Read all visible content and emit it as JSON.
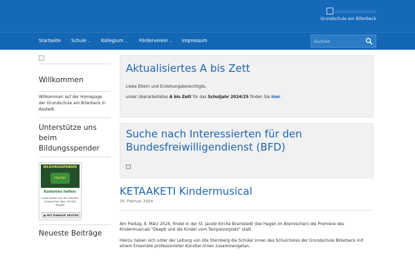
{
  "header": {
    "logo_alt": "",
    "tagline": "Grundschule am Billerbeck"
  },
  "nav": {
    "items": [
      {
        "label": "Startseite",
        "has_dropdown": false
      },
      {
        "label": "Schule",
        "has_dropdown": true
      },
      {
        "label": "Kollegium",
        "has_dropdown": true
      },
      {
        "label": "Förderverein",
        "has_dropdown": true
      },
      {
        "label": "Impressum",
        "has_dropdown": false
      }
    ],
    "search_placeholder": "Suchen"
  },
  "sidebar": {
    "welcome_title": "Willkommen",
    "welcome_text": "Willkommen auf der Homepage der Grundschule am Billerbeck in Axstedt.",
    "support_title": "Unterstütze uns beim Bildungsspender",
    "ad": {
      "title": "BILDUNGSSPENDER",
      "badge": "Hurra!",
      "kostenlos": "Kostenlos helfen:",
      "text": "Unterstütze uns mit Deinem Einkauf bei über 30.000 Shops!",
      "button": "MIT EINKAUF HELFEN"
    },
    "recent_title": "Neueste Beiträge"
  },
  "main": {
    "box1": {
      "title": "Aktualisiertes A bis Zett",
      "greeting": "Liebe Eltern und Erziehungsberechtigte,",
      "line_pre": "unser überarbeitetes ",
      "line_bold1": "A bis Zett",
      "line_mid": " für das ",
      "line_bold2": "Schuljahr 2024/25",
      "line_post": " finden Sie ",
      "link": "hier",
      "line_end": "."
    },
    "box2": {
      "title": "Suche nach Interessierten für den Bundesfreiwilligendienst (BFD)"
    },
    "post": {
      "title": "KETAAKETI Kindermusical",
      "date": "25. Februar 2024",
      "p1": "Am Freitag, 8. März 2024, findet in der St. Jacobi Kirche Bramstedt (bei Hagen im Bremischen) die Premiere des Kindermusicals \"Deepti und die Kinder vom Tempelvorplatz\" statt.",
      "p2": "Hierzu haben sich unter der Leitung von Ute Sternberg die Schüler:innen des Schulchores der Grundschule Billerbeck mit einem Ensemble professioneller Künstler:innen zusammengetan."
    }
  },
  "colors": {
    "header_bg": "#1669b8",
    "title_blue": "#1e66ae",
    "box_bg": "#f1f1f1"
  }
}
